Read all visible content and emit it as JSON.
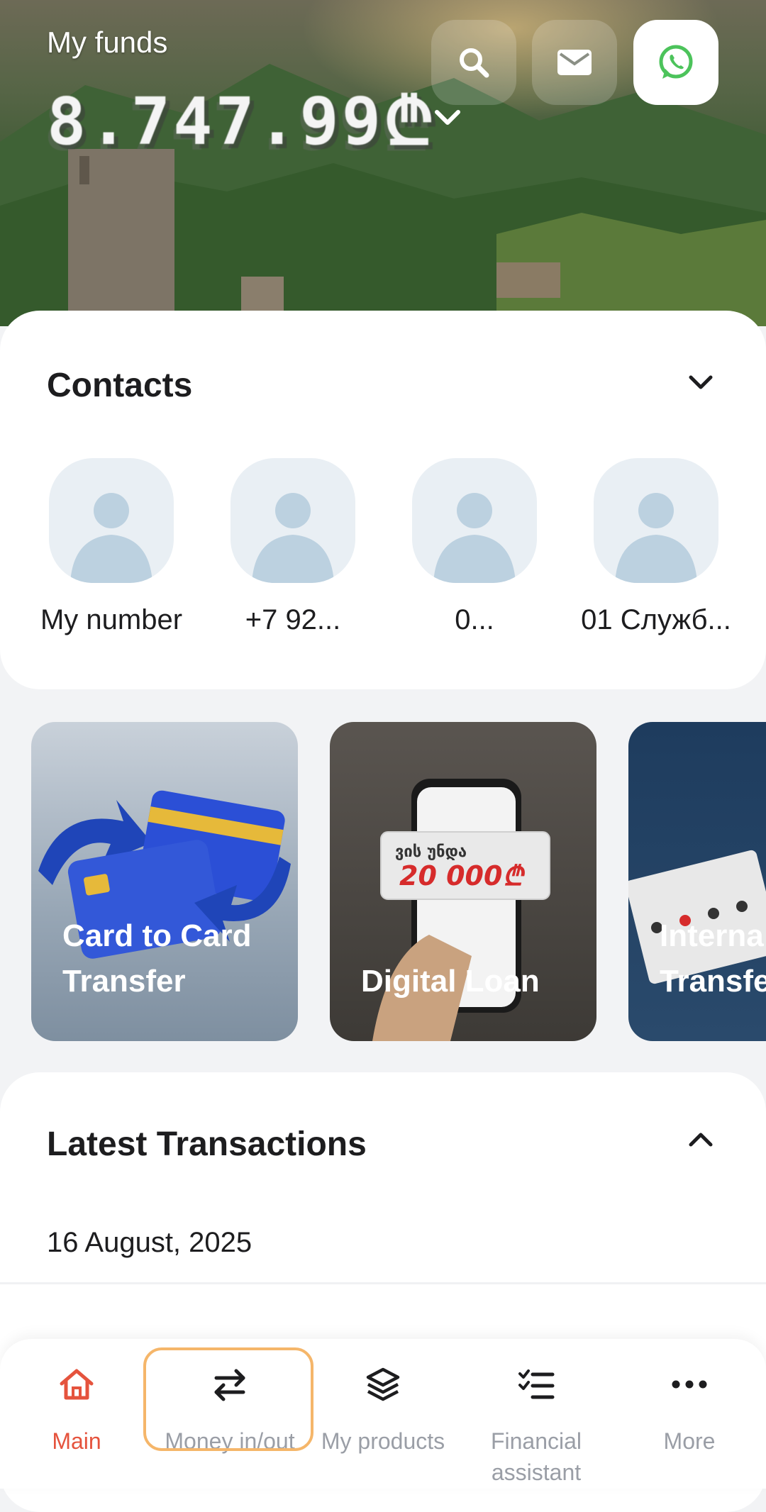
{
  "hero": {
    "funds_label": "My funds",
    "balance_masked": "8.747.99₾",
    "buttons": [
      "search-icon",
      "mail-icon",
      "whatsapp-icon"
    ]
  },
  "contacts": {
    "title": "Contacts",
    "items": [
      {
        "name": "My number"
      },
      {
        "name": "+7 92..."
      },
      {
        "name": "0..."
      },
      {
        "name": "01 Служб..."
      }
    ]
  },
  "promos": [
    {
      "label_line1": "Card to Card",
      "label_line2": "Transfer"
    },
    {
      "label_line1": "Digital Loan",
      "label_line2": ""
    },
    {
      "label_line1": "Interna",
      "label_line2": "Transfe"
    }
  ],
  "transactions": {
    "title": "Latest Transactions",
    "date": "16 August, 2025"
  },
  "nav": {
    "items": [
      {
        "label": "Main"
      },
      {
        "label": "Money in/out"
      },
      {
        "label": "My products"
      },
      {
        "label": "Financial assistant"
      },
      {
        "label": "More"
      }
    ]
  },
  "colors": {
    "accent": "#e5533d",
    "highlight": "#f5b66a",
    "whatsapp": "#4cc35b",
    "avatar_bg": "#e9eff4",
    "avatar_fg": "#bcd1e0"
  }
}
